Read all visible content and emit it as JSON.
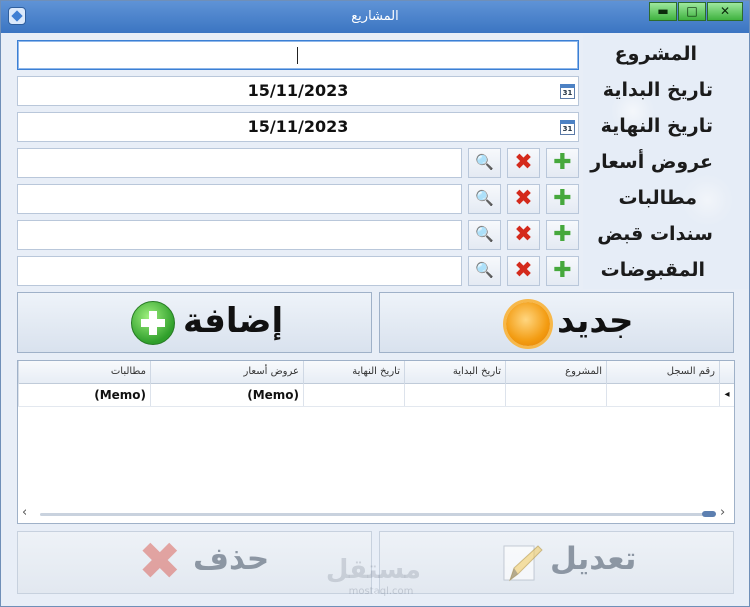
{
  "window": {
    "title": "المشاريع",
    "controls": {
      "minimize": "▬",
      "maximize": "□",
      "close": "✕"
    }
  },
  "form": {
    "project_label": "المشروع",
    "project_value": "",
    "start_date_label": "تاريخ البداية",
    "start_date_value": "15/11/2023",
    "end_date_label": "تاريخ النهاية",
    "end_date_value": "15/11/2023",
    "calendar_icon_text": "31",
    "quotes_label": "عروض أسعار",
    "claims_label": "مطالبات",
    "receipts_label": "سندات قبض",
    "collections_label": "المقبوضات"
  },
  "buttons": {
    "add": "إضافة",
    "new": "جديد",
    "delete": "حذف",
    "edit": "تعديل"
  },
  "grid": {
    "columns": [
      "رقم السجل",
      "المشروع",
      "تاريخ البداية",
      "تاريخ النهاية",
      "عروض أسعار",
      "مطالبات"
    ],
    "row": [
      "",
      "",
      "",
      "",
      "(Memo)",
      "(Memo)"
    ]
  },
  "watermark": {
    "text": "مستقل",
    "sub": "mostaql.com"
  },
  "colors": {
    "titlebar": "#3b75c2",
    "plus": "#46a83c",
    "delete": "#d42a1c",
    "add_circle": "#2f9f2b",
    "sun": "#f39c12"
  }
}
